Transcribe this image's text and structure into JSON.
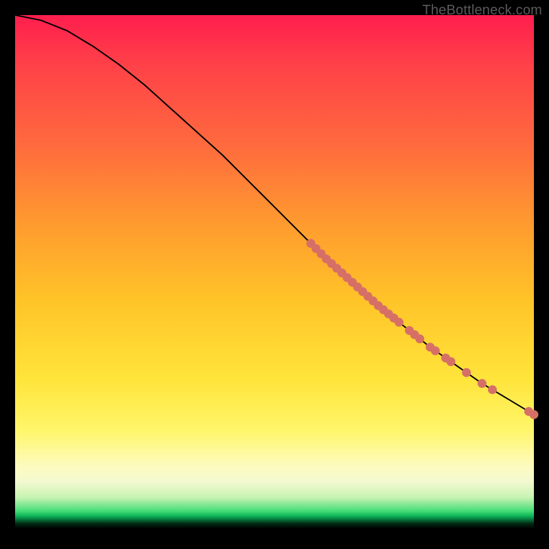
{
  "watermark": "TheBottleneck.com",
  "chart_data": {
    "type": "line",
    "title": "",
    "xlabel": "",
    "ylabel": "",
    "xlim": [
      0,
      100
    ],
    "ylim": [
      0,
      100
    ],
    "curve": [
      {
        "x": 0,
        "y": 100
      },
      {
        "x": 5,
        "y": 99
      },
      {
        "x": 10,
        "y": 97
      },
      {
        "x": 15,
        "y": 94
      },
      {
        "x": 20,
        "y": 90.5
      },
      {
        "x": 25,
        "y": 86.5
      },
      {
        "x": 30,
        "y": 82
      },
      {
        "x": 35,
        "y": 77.5
      },
      {
        "x": 40,
        "y": 73
      },
      {
        "x": 45,
        "y": 68
      },
      {
        "x": 50,
        "y": 63
      },
      {
        "x": 55,
        "y": 58
      },
      {
        "x": 60,
        "y": 53
      },
      {
        "x": 65,
        "y": 48.5
      },
      {
        "x": 70,
        "y": 44
      },
      {
        "x": 75,
        "y": 40
      },
      {
        "x": 80,
        "y": 36
      },
      {
        "x": 85,
        "y": 32.5
      },
      {
        "x": 90,
        "y": 29
      },
      {
        "x": 95,
        "y": 26
      },
      {
        "x": 100,
        "y": 23
      }
    ],
    "highlighted_points": [
      {
        "x": 57,
        "y": 56.0
      },
      {
        "x": 58,
        "y": 55.0
      },
      {
        "x": 59,
        "y": 54.0
      },
      {
        "x": 60,
        "y": 53.0
      },
      {
        "x": 61,
        "y": 52.1
      },
      {
        "x": 62,
        "y": 51.2
      },
      {
        "x": 63,
        "y": 50.3
      },
      {
        "x": 64,
        "y": 49.4
      },
      {
        "x": 65,
        "y": 48.5
      },
      {
        "x": 66,
        "y": 47.6
      },
      {
        "x": 67,
        "y": 46.7
      },
      {
        "x": 68,
        "y": 45.8
      },
      {
        "x": 69,
        "y": 44.9
      },
      {
        "x": 70,
        "y": 44.0
      },
      {
        "x": 71,
        "y": 43.2
      },
      {
        "x": 72,
        "y": 42.4
      },
      {
        "x": 73,
        "y": 41.6
      },
      {
        "x": 74,
        "y": 40.8
      },
      {
        "x": 76,
        "y": 39.2
      },
      {
        "x": 77,
        "y": 38.4
      },
      {
        "x": 78,
        "y": 37.6
      },
      {
        "x": 80,
        "y": 36.0
      },
      {
        "x": 81,
        "y": 35.3
      },
      {
        "x": 83,
        "y": 33.9
      },
      {
        "x": 84,
        "y": 33.2
      },
      {
        "x": 87,
        "y": 31.1
      },
      {
        "x": 90,
        "y": 29.0
      },
      {
        "x": 92,
        "y": 27.8
      },
      {
        "x": 99,
        "y": 23.6
      },
      {
        "x": 100,
        "y": 23.0
      }
    ],
    "colors": {
      "curve": "#000000",
      "point_fill": "#d67066",
      "point_stroke": "#d67066"
    }
  }
}
